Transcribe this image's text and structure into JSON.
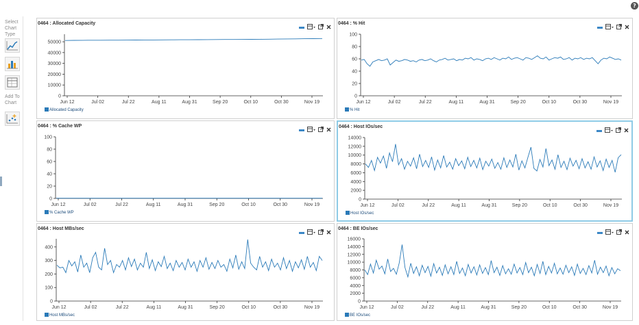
{
  "help_icon": "?",
  "sidebar": {
    "select_label": "Select Chart Type",
    "add_label": "Add To Chart",
    "buttons": [
      "line-chart-icon",
      "bar-chart-icon",
      "table-icon",
      "scatter-add-icon"
    ]
  },
  "chart_data": [
    {
      "id": "allocated",
      "type": "line",
      "title": "0464 : Allocated Capacity",
      "x_ticks": [
        "Jun 12",
        "Jul 02",
        "Jul 22",
        "Aug 11",
        "Aug 31",
        "Sep 20",
        "Oct 10",
        "Oct 30",
        "Nov 19"
      ],
      "y_ticks": [
        0,
        10000,
        20000,
        30000,
        40000,
        50000
      ],
      "ylim": [
        0,
        57000
      ],
      "series": [
        {
          "name": "Allocated Capacity",
          "color": "#2a7ab8",
          "values": [
            51200,
            51300,
            51350,
            51400,
            51450,
            51500,
            51500,
            51550,
            51600,
            51650,
            51700,
            51750,
            51800,
            51850,
            51900,
            51950,
            52000,
            52050,
            52100,
            52150,
            52200,
            52250,
            52300,
            52400,
            52500,
            52600,
            52700,
            52800,
            52900,
            53000
          ]
        }
      ]
    },
    {
      "id": "hit",
      "type": "line",
      "title": "0464 : % Hit",
      "x_ticks": [
        "Jun 12",
        "Jul 02",
        "Jul 22",
        "Aug 11",
        "Aug 31",
        "Sep 20",
        "Oct 10",
        "Oct 30",
        "Nov 19"
      ],
      "y_ticks": [
        0,
        20,
        40,
        60,
        80,
        100
      ],
      "ylim": [
        0,
        100
      ],
      "series": [
        {
          "name": "% Hit",
          "color": "#2a7ab8",
          "values": [
            58,
            59,
            52,
            48,
            55,
            57,
            59,
            57,
            58,
            60,
            50,
            54,
            58,
            56,
            57,
            59,
            58,
            56,
            57,
            55,
            58,
            59,
            57,
            58,
            60,
            57,
            55,
            58,
            59,
            61,
            58,
            59,
            60,
            57,
            59,
            58,
            61,
            60,
            62,
            58,
            60,
            59,
            57,
            60,
            61,
            59,
            62,
            60,
            58,
            61,
            60,
            63,
            59,
            61,
            62,
            60,
            58,
            62,
            61,
            59,
            62,
            65,
            61,
            60,
            63,
            58,
            60,
            62,
            61,
            63,
            59,
            60,
            62,
            58,
            61,
            60,
            62,
            59,
            61,
            60,
            62,
            57,
            52,
            58,
            61,
            60,
            63,
            61,
            59,
            60,
            58
          ]
        }
      ]
    },
    {
      "id": "cachewp",
      "type": "line",
      "title": "0464 : % Cache WP",
      "x_ticks": [
        "Jun 12",
        "Jul 02",
        "Jul 22",
        "Aug 11",
        "Aug 31",
        "Sep 20",
        "Oct 10",
        "Oct 30",
        "Nov 19"
      ],
      "y_ticks": [
        0,
        20,
        40,
        60,
        80,
        100
      ],
      "ylim": [
        0,
        100
      ],
      "series": [
        {
          "name": "% Cache WP",
          "color": "#2a7ab8",
          "values": [
            0.3,
            0.3,
            0.3,
            0.3,
            0.3,
            0.3,
            0.3,
            0.3,
            0.3,
            0.3,
            0.3,
            0.3,
            0.3,
            0.3,
            0.3,
            0.3,
            0.3,
            0.3,
            0.3,
            0.3
          ]
        }
      ]
    },
    {
      "id": "hostios",
      "type": "line",
      "title": "0464 : Host IOs/sec",
      "x_ticks": [
        "Jun 12",
        "Jul 02",
        "Jul 22",
        "Aug 11",
        "Aug 31",
        "Sep 20",
        "Oct 10",
        "Oct 30",
        "Nov 19"
      ],
      "y_ticks": [
        0,
        2000,
        4000,
        6000,
        8000,
        10000,
        12000,
        14000
      ],
      "ylim": [
        0,
        14000
      ],
      "series": [
        {
          "name": "Host IOs/sec",
          "color": "#2a7ab8",
          "values": [
            8000,
            7200,
            8800,
            6500,
            9500,
            8200,
            9800,
            7000,
            10500,
            8500,
            12500,
            7800,
            9200,
            6800,
            8600,
            7500,
            9400,
            6900,
            10200,
            7400,
            8800,
            7200,
            9600,
            6600,
            8900,
            7100,
            9900,
            7300,
            8400,
            6800,
            9200,
            7600,
            8700,
            6900,
            9500,
            7400,
            8800,
            7100,
            9300,
            6700,
            8600,
            7500,
            9100,
            7000,
            8300,
            6800,
            9400,
            7200,
            8900,
            7300,
            10200,
            6600,
            8700,
            7100,
            9500,
            11800,
            7000,
            6400,
            9000,
            7300,
            11500,
            7600,
            8900,
            6800,
            10100,
            7200,
            8600,
            6700,
            9300,
            7500,
            8800,
            6900,
            9200,
            7100,
            8500,
            6800,
            9600,
            7300,
            8700,
            6500,
            9100,
            7200,
            8800,
            6100,
            9400,
            10100
          ]
        }
      ]
    },
    {
      "id": "hostmbs",
      "type": "line",
      "title": "0464 : Host MBs/sec",
      "x_ticks": [
        "Jun 12",
        "Jul 02",
        "Jul 22",
        "Aug 11",
        "Aug 31",
        "Sep 20",
        "Oct 10",
        "Oct 30",
        "Nov 19"
      ],
      "y_ticks": [
        0,
        100,
        200,
        300,
        400
      ],
      "ylim": [
        0,
        460
      ],
      "series": [
        {
          "name": "Host MBs/sec",
          "color": "#2a7ab8",
          "values": [
            265,
            245,
            250,
            210,
            300,
            260,
            290,
            215,
            340,
            250,
            280,
            210,
            320,
            360,
            250,
            230,
            390,
            270,
            300,
            210,
            270,
            250,
            300,
            230,
            320,
            255,
            310,
            230,
            280,
            250,
            360,
            240,
            305,
            225,
            290,
            255,
            330,
            240,
            280,
            225,
            300,
            250,
            285,
            230,
            310,
            250,
            290,
            220,
            300,
            250,
            320,
            235,
            285,
            240,
            300,
            250,
            270,
            220,
            310,
            245,
            340,
            235,
            290,
            240,
            455,
            280,
            250,
            230,
            330,
            250,
            290,
            225,
            310,
            250,
            280,
            230,
            320,
            240,
            300,
            220,
            290,
            245,
            305,
            235,
            330,
            250,
            285,
            225,
            330,
            300
          ]
        }
      ]
    },
    {
      "id": "beios",
      "type": "line",
      "title": "0464 : BE IOs/sec",
      "x_ticks": [
        "Jun 12",
        "Jul 02",
        "Jul 22",
        "Aug 11",
        "Aug 31",
        "Sep 20",
        "Oct 10",
        "Oct 30",
        "Nov 19"
      ],
      "y_ticks": [
        0,
        2000,
        4000,
        6000,
        8000,
        10000,
        12000,
        14000,
        16000
      ],
      "ylim": [
        0,
        16000
      ],
      "series": [
        {
          "name": "BE IOs/sec",
          "color": "#2a7ab8",
          "values": [
            8000,
            6800,
            9500,
            7200,
            10500,
            8200,
            9000,
            7000,
            10800,
            7600,
            8400,
            6900,
            9800,
            14500,
            8600,
            6200,
            9700,
            7100,
            8800,
            6500,
            9200,
            7300,
            8900,
            6400,
            9600,
            7200,
            8700,
            6600,
            9300,
            7000,
            8800,
            6800,
            10200,
            7100,
            8500,
            6500,
            9400,
            7200,
            8800,
            6700,
            9300,
            7100,
            8600,
            6800,
            10400,
            7300,
            8700,
            6600,
            9100,
            7000,
            8300,
            6900,
            9500,
            7200,
            8600,
            6800,
            9900,
            7300,
            8700,
            6500,
            9400,
            7100,
            10200,
            6800,
            8900,
            7200,
            9700,
            7000,
            8500,
            6900,
            9200,
            7300,
            8800,
            6600,
            9500,
            7100,
            8400,
            6800,
            9100,
            7200,
            10500,
            6900,
            8700,
            7300,
            9000,
            6500,
            8600,
            7000,
            8300,
            7800
          ]
        }
      ]
    }
  ]
}
